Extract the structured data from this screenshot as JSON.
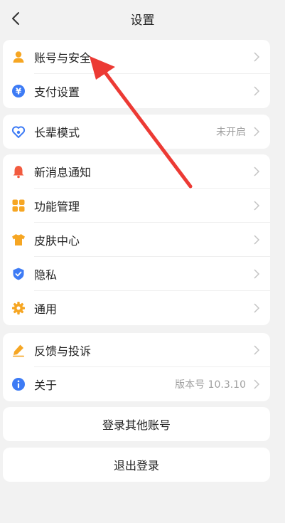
{
  "header": {
    "title": "设置"
  },
  "colors": {
    "accent_blue": "#3d7bf5",
    "orange": "#f6a623",
    "red": "#f25b3f",
    "annotation_red": "#ec3a34"
  },
  "group1": {
    "items": [
      {
        "label": "账号与安全",
        "icon": "user-icon"
      },
      {
        "label": "支付设置",
        "icon": "yuan-icon"
      }
    ]
  },
  "group2": {
    "items": [
      {
        "label": "长辈模式",
        "value": "未开启",
        "icon": "heart-shield-icon"
      }
    ]
  },
  "group3": {
    "items": [
      {
        "label": "新消息通知",
        "icon": "bell-icon"
      },
      {
        "label": "功能管理",
        "icon": "grid-icon"
      },
      {
        "label": "皮肤中心",
        "icon": "shirt-icon"
      },
      {
        "label": "隐私",
        "icon": "shield-check-icon"
      },
      {
        "label": "通用",
        "icon": "gear-icon"
      }
    ]
  },
  "group4": {
    "items": [
      {
        "label": "反馈与投诉",
        "icon": "pen-icon"
      },
      {
        "label": "关于",
        "value": "版本号 10.3.10",
        "icon": "info-icon"
      }
    ]
  },
  "buttons": {
    "switch_account": "登录其他账号",
    "logout": "退出登录"
  }
}
